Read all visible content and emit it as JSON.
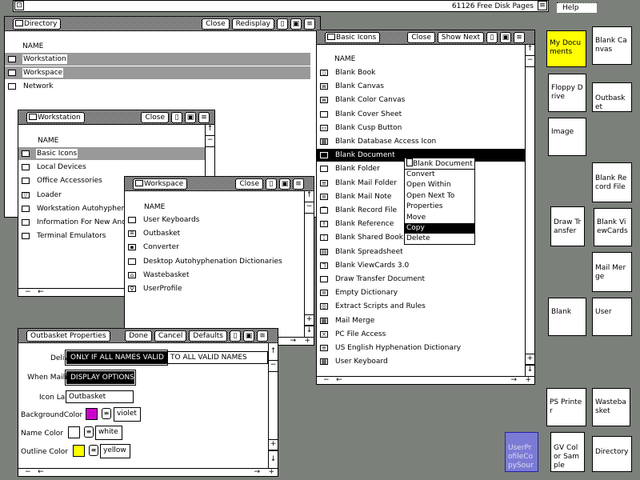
{
  "topbar": {
    "disk_pages": "61126 Free Disk Pages",
    "help": "Help"
  },
  "colors": {
    "desktop": "#7b807a",
    "my_documents": "#ffff00",
    "user_profile": "#7b7bd6",
    "violet": "#cc00cc",
    "yellow": "#ffff00"
  },
  "directory": {
    "title": "Directory",
    "buttons": [
      "Close",
      "Redisplay"
    ],
    "header": "NAME",
    "items": [
      {
        "label": "Workstation",
        "icon": "folder-icon",
        "selected": true
      },
      {
        "label": "Workspace",
        "icon": "folder-icon",
        "selected": true
      },
      {
        "label": "Network",
        "icon": "folder-icon"
      }
    ]
  },
  "basic_icons": {
    "title": "Basic Icons",
    "buttons": [
      "Close",
      "Show Next"
    ],
    "header": "NAME",
    "items": [
      {
        "label": "Blank Book",
        "icon": "book-icon"
      },
      {
        "label": "Blank Canvas",
        "icon": "canvas-icon"
      },
      {
        "label": "Blank Color Canvas",
        "icon": "canvas-icon"
      },
      {
        "label": "Blank Cover Sheet",
        "icon": "document-icon"
      },
      {
        "label": "Blank Cusp Button",
        "icon": "button-icon"
      },
      {
        "label": "Blank Database Access Icon",
        "icon": "database-icon"
      },
      {
        "label": "Blank Document",
        "icon": "document-icon",
        "active": true
      },
      {
        "label": "Blank Folder",
        "icon": "folder-icon"
      },
      {
        "label": "Blank Mail Folder",
        "icon": "mail-folder-icon"
      },
      {
        "label": "Blank Mail Note",
        "icon": "mail-note-icon"
      },
      {
        "label": "Blank Record File",
        "icon": "record-file-icon"
      },
      {
        "label": "Blank Reference",
        "icon": "reference-icon"
      },
      {
        "label": "Blank Shared Book",
        "icon": "shared-book-icon"
      },
      {
        "label": "Blank Spreadsheet",
        "icon": "spreadsheet-icon"
      },
      {
        "label": "Blank ViewCards 3.0",
        "icon": "viewcards-icon"
      },
      {
        "label": "Draw Transfer Document",
        "icon": "document-icon"
      },
      {
        "label": "Empty Dictionary",
        "icon": "dictionary-icon"
      },
      {
        "label": "Extract Scripts and Rules",
        "icon": "script-icon"
      },
      {
        "label": "Mail Merge",
        "icon": "mail-merge-icon"
      },
      {
        "label": "PC File Access",
        "icon": "pc-file-icon"
      },
      {
        "label": "US English Hyphenation Dictionary",
        "icon": "dictionary-icon"
      },
      {
        "label": "User Keyboard",
        "icon": "keyboard-icon"
      }
    ]
  },
  "popup": {
    "header": "Blank Document",
    "items": [
      "Convert",
      "Open Within",
      "Open Next To",
      "Properties",
      "Move",
      "Copy",
      "Delete"
    ],
    "highlighted": "Copy"
  },
  "workstation": {
    "title": "Workstation",
    "buttons": [
      "Close"
    ],
    "header": "NAME",
    "items": [
      {
        "label": "Basic Icons",
        "icon": "folder-icon",
        "selected": true
      },
      {
        "label": "Local Devices",
        "icon": "folder-icon"
      },
      {
        "label": "Office Accessories",
        "icon": "folder-icon"
      },
      {
        "label": "Loader",
        "icon": "loader-icon"
      },
      {
        "label": "Workstation Autohyphenation Dictionaries",
        "icon": "folder-icon"
      },
      {
        "label": "Information For New Android Users",
        "icon": "folder-icon"
      },
      {
        "label": "Terminal Emulators",
        "icon": "folder-icon"
      }
    ]
  },
  "workspace": {
    "title": "Workspace",
    "buttons": [
      "Close"
    ],
    "header": "NAME",
    "items": [
      {
        "label": "User Keyboards",
        "icon": "folder-icon"
      },
      {
        "label": "Outbasket",
        "icon": "outbasket-icon"
      },
      {
        "label": "Converter",
        "icon": "converter-icon"
      },
      {
        "label": "Desktop Autohyphenation Dictionaries",
        "icon": "folder-icon"
      },
      {
        "label": "Wastebasket",
        "icon": "wastebasket-icon"
      },
      {
        "label": "UserProfile",
        "icon": "user-profile-icon"
      }
    ]
  },
  "properties": {
    "title": "Outbasket Properties",
    "buttons": [
      "Done",
      "Cancel",
      "Defaults"
    ],
    "deliver_label": "Deliver",
    "deliver_options": [
      "ONLY IF ALL NAMES VALID",
      "TO ALL VALID NAMES"
    ],
    "mailing_label": "When Mailing",
    "mailing_option": "DISPLAY OPTIONS",
    "icon_label_label": "Icon Label",
    "icon_label_value": "Outbasket",
    "bg_label": "BackgroundColor",
    "bg_value": "violet",
    "name_color_label": "Name Color",
    "name_color_value": "white",
    "outline_label": "Outline Color",
    "outline_value": "yellow"
  },
  "desktop_icons": [
    {
      "id": "my-documents",
      "label": "My Documents"
    },
    {
      "id": "blank-canvas",
      "label": "Blank Canvas"
    },
    {
      "id": "floppy-drive",
      "label": "Floppy Drive"
    },
    {
      "id": "outbasket",
      "label": "Outbasket"
    },
    {
      "id": "image",
      "label": "Image"
    },
    {
      "id": "blank-record-file",
      "label": "Blank Record File"
    },
    {
      "id": "draw-transfer",
      "label": "Draw Transfer"
    },
    {
      "id": "blank-viewcards",
      "label": "Blank ViewCards"
    },
    {
      "id": "mail-merge",
      "label": "Mail Merge"
    },
    {
      "id": "blank",
      "label": "Blank"
    },
    {
      "id": "user",
      "label": "User"
    },
    {
      "id": "ps-printer",
      "label": "PS Printer"
    },
    {
      "id": "wastebasket",
      "label": "Wastebasket"
    },
    {
      "id": "user-profile-copy-source",
      "label": "UserProfileCopySource"
    },
    {
      "id": "gv-color-sample",
      "label": "GV Color Sample"
    },
    {
      "id": "directory",
      "label": "Directory"
    }
  ]
}
